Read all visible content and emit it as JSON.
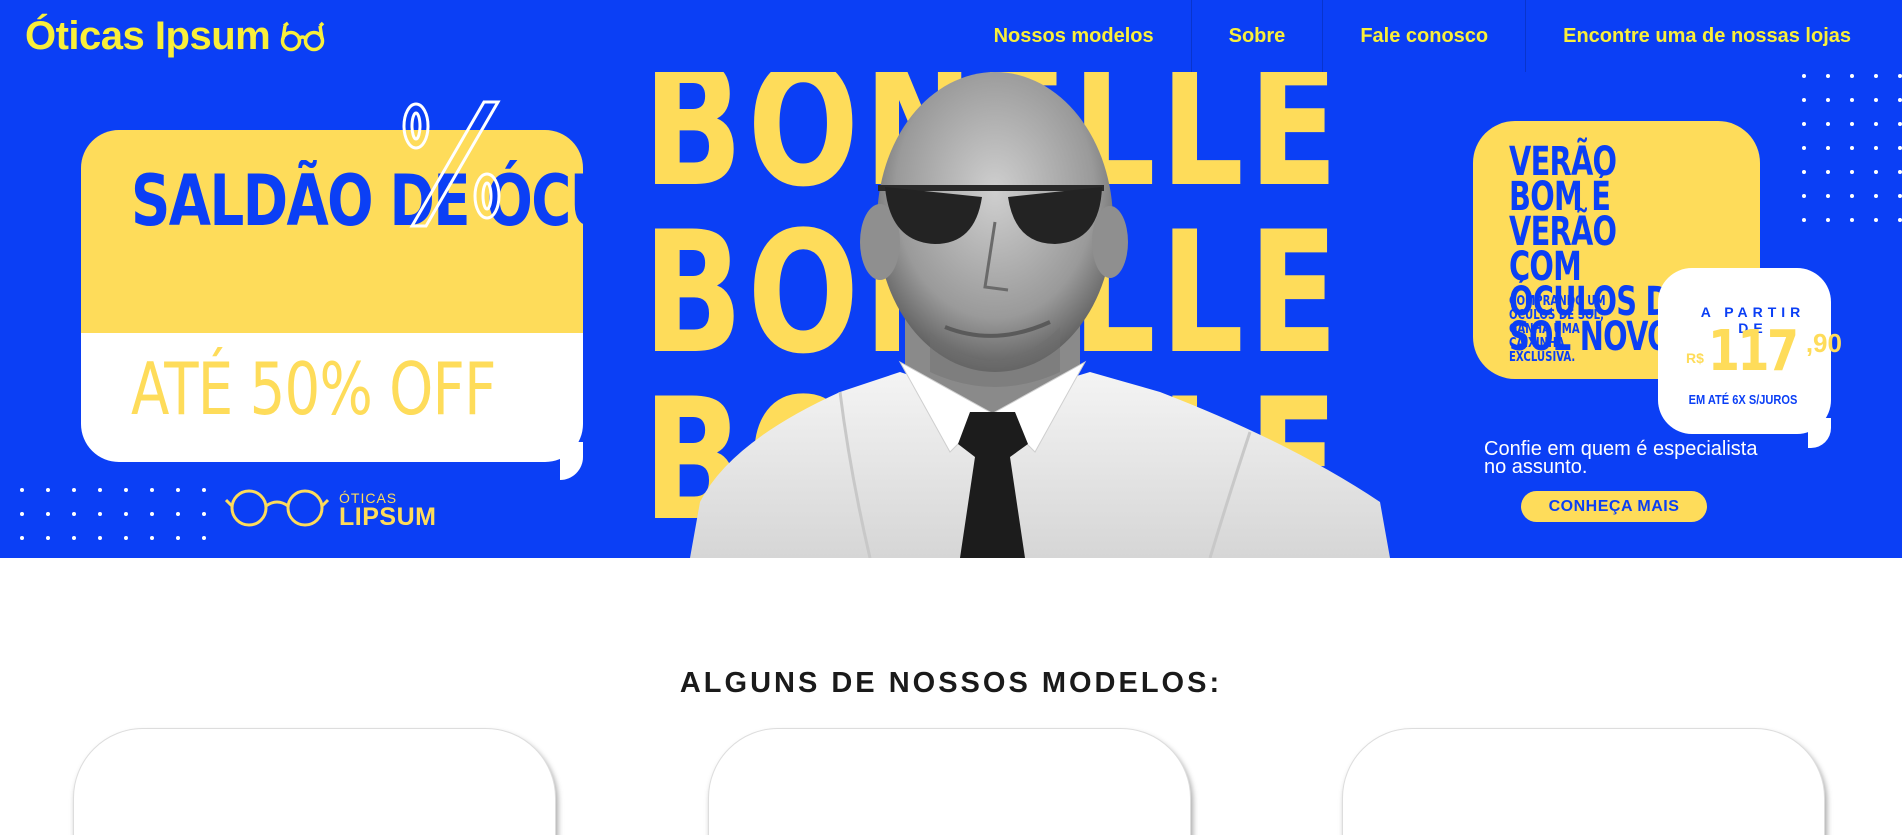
{
  "header": {
    "brand": "Óticas Ipsum",
    "brand_icon": "glasses-icon",
    "nav": [
      {
        "label": "Nossos modelos"
      },
      {
        "label": "Sobre"
      },
      {
        "label": "Fale conosco"
      },
      {
        "label": "Encontre uma de nossas lojas"
      }
    ]
  },
  "hero": {
    "sale_title": "SALDÃO DE ÓCULOS",
    "sale_off": "ATÉ 50% OFF",
    "percent_symbol": "%",
    "mini_logo": {
      "small": "ÓTICAS",
      "big": "LIPSUM"
    },
    "big_word": "BONELLE",
    "summer_title": "VERÃO BOM É VERÃO COM ÓCULOS DE SOL NOVO",
    "summer_sub": "COMPRANDO UM ÓCULOS DE SOL, GANHA UMA CAIXINHA EXCLUSIVA.",
    "price": {
      "from": "A PARTIR DE",
      "currency": "R$",
      "integer": "117",
      "decimal": ",90",
      "terms": "EM ATÉ 6X S/JUROS"
    },
    "trust_text": "Confie em quem é especialista no assunto.",
    "cta": "CONHEÇA MAIS"
  },
  "models": {
    "title": "ALGUNS DE NOSSOS MODELOS:",
    "cards": [
      {},
      {},
      {}
    ]
  },
  "colors": {
    "brand_blue": "#0b3ff5",
    "brand_yellow": "#fedc5a",
    "nav_yellow": "#f9ef3a"
  }
}
